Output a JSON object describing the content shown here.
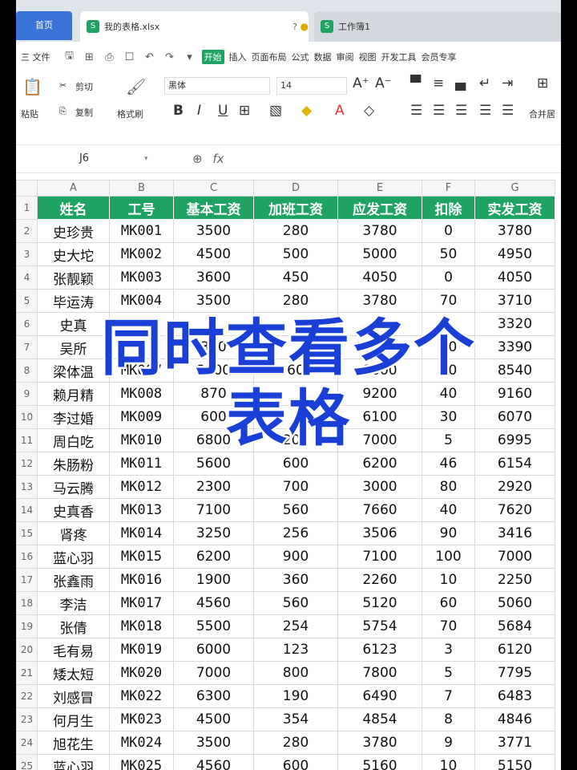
{
  "tabs": {
    "home": "首页",
    "file": "我的表格.xlsx",
    "workbook": "工作簿1",
    "file_badge": "S",
    "more": "?",
    "dot": "●"
  },
  "menu": {
    "file": "三 文件",
    "items": [
      "开始",
      "插入",
      "页面布局",
      "公式",
      "数据",
      "审阅",
      "视图",
      "开发工具",
      "会员专享"
    ]
  },
  "ribbon": {
    "paste": "粘贴",
    "cut": "剪切",
    "copy": "复制",
    "format_painter": "格式刷",
    "font": "黑体",
    "size": "14",
    "merge": "合并居",
    "bold": "B",
    "italic": "I",
    "underline": "U"
  },
  "formula": {
    "cell": "J6",
    "fx": "fx"
  },
  "sheet": {
    "columns": [
      "A",
      "B",
      "C",
      "D",
      "E",
      "F",
      "G"
    ],
    "headers": [
      "姓名",
      "工号",
      "基本工资",
      "加班工资",
      "应发工资",
      "扣除",
      "实发工资"
    ],
    "rows": [
      [
        "史珍贵",
        "MK001",
        "3500",
        "280",
        "3780",
        "0",
        "3780"
      ],
      [
        "史大坨",
        "MK002",
        "4500",
        "500",
        "5000",
        "50",
        "4950"
      ],
      [
        "张靓颖",
        "MK003",
        "3600",
        "450",
        "4050",
        "0",
        "4050"
      ],
      [
        "毕运涛",
        "MK004",
        "3500",
        "280",
        "3780",
        "70",
        "3710"
      ],
      [
        "史真",
        "",
        "",
        "",
        "",
        "",
        "3320"
      ],
      [
        "吴所",
        "",
        "300",
        "",
        "",
        "10",
        "3390"
      ],
      [
        "梁体温",
        "MK007",
        "8000",
        "60",
        "8600",
        "60",
        "8540"
      ],
      [
        "赖月精",
        "MK008",
        "870",
        "",
        "9200",
        "40",
        "9160"
      ],
      [
        "李过婚",
        "MK009",
        "600",
        "",
        "6100",
        "30",
        "6070"
      ],
      [
        "周白吃",
        "MK010",
        "6800",
        "200",
        "7000",
        "5",
        "6995"
      ],
      [
        "朱肠粉",
        "MK011",
        "5600",
        "600",
        "6200",
        "46",
        "6154"
      ],
      [
        "马云腾",
        "MK012",
        "2300",
        "700",
        "3000",
        "80",
        "2920"
      ],
      [
        "史真香",
        "MK013",
        "7100",
        "560",
        "7660",
        "40",
        "7620"
      ],
      [
        "肾疼",
        "MK014",
        "3250",
        "256",
        "3506",
        "90",
        "3416"
      ],
      [
        "蓝心羽",
        "MK015",
        "6200",
        "900",
        "7100",
        "100",
        "7000"
      ],
      [
        "张鑫雨",
        "MK016",
        "1900",
        "360",
        "2260",
        "10",
        "2250"
      ],
      [
        "李洁",
        "MK017",
        "4560",
        "560",
        "5120",
        "60",
        "5060"
      ],
      [
        "张倩",
        "MK018",
        "5500",
        "254",
        "5754",
        "70",
        "5684"
      ],
      [
        "毛有易",
        "MK019",
        "6000",
        "123",
        "6123",
        "3",
        "6120"
      ],
      [
        "矮太短",
        "MK020",
        "7000",
        "800",
        "7800",
        "5",
        "7795"
      ],
      [
        "刘感冒",
        "MK022",
        "6300",
        "190",
        "6490",
        "7",
        "6483"
      ],
      [
        "何月生",
        "MK023",
        "4500",
        "354",
        "4854",
        "8",
        "4846"
      ],
      [
        "旭花生",
        "MK024",
        "3500",
        "280",
        "3780",
        "9",
        "3771"
      ],
      [
        "蓝心羽",
        "MK025",
        "4560",
        "600",
        "5160",
        "10",
        "5150"
      ]
    ]
  },
  "caption": {
    "line1": "同时查看多个",
    "line2": "表格"
  }
}
